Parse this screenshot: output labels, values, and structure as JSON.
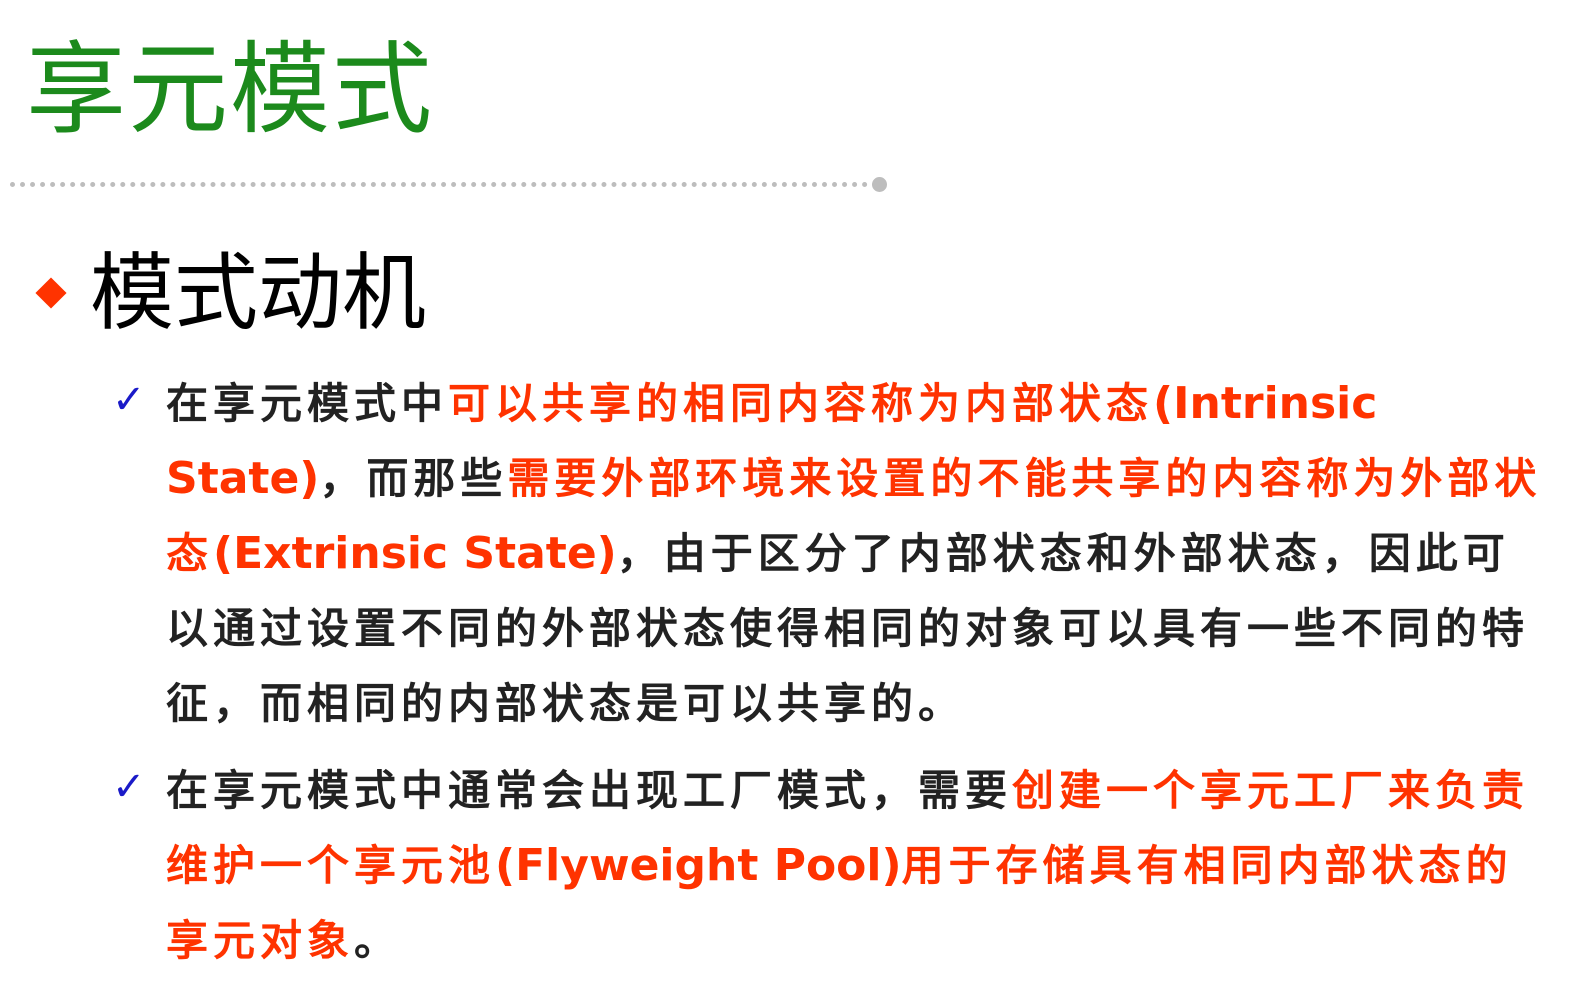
{
  "slide": {
    "title": "享元模式",
    "section_heading": "模式动机"
  },
  "colors": {
    "title": "#1c8a1c",
    "highlight": "#ff3300",
    "check": "#1a1ac8",
    "body_text": "#222222"
  },
  "icons": {
    "section_bullet": "diamond-bullet-icon",
    "item_bullet": "checkmark-icon"
  },
  "bullets": [
    {
      "check": "✓",
      "p1": "在享元模式中",
      "h1": "可以共享的相同内容称为内部状态",
      "h1en": "(Intrinsic State)",
      "p2": "，而那些",
      "h2": "需要外部环境来设置的不能共享的内容称为外部状态",
      "h2en": "(Extrinsic State)",
      "p3": "，由于区分了内部状态和外部状态，因此可以通过设置不同的外部状态使得相同的对象可以具有一些不同的特征，而相同的内部状态是可以共享的。"
    },
    {
      "check": "✓",
      "p1": "在享元模式中通常会出现工厂模式，需要",
      "h1": "创建一个享元工厂来负责维护一个享元池",
      "h1en": "(Flyweight Pool)",
      "h2": "用于存储具有相同内部状态的享元对象",
      "p2": "。"
    }
  ]
}
